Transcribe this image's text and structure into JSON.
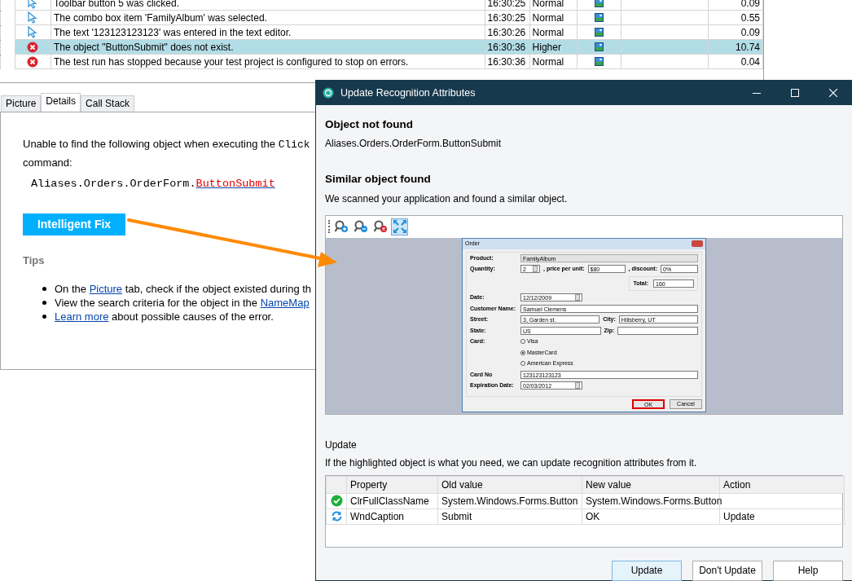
{
  "log": {
    "rows": [
      {
        "kind": "click",
        "message": "Toolbar button 5 was clicked.",
        "time": "16:30:25",
        "priority": "Normal",
        "value": "0.09",
        "selected": false
      },
      {
        "kind": "click",
        "message": "The combo box item 'FamilyAlbum' was selected.",
        "time": "16:30:25",
        "priority": "Normal",
        "value": "0.55",
        "selected": false
      },
      {
        "kind": "click",
        "message": "The text '123123123123' was entered in the text editor.",
        "time": "16:30:26",
        "priority": "Normal",
        "value": "0.09",
        "selected": false
      },
      {
        "kind": "error",
        "message": "The object \"ButtonSubmit\" does not exist.",
        "time": "16:30:36",
        "priority": "Higher",
        "value": "10.74",
        "selected": true
      },
      {
        "kind": "error",
        "message": "The test run has stopped because your test project is configured to stop on errors.",
        "time": "16:30:36",
        "priority": "Normal",
        "value": "0.04",
        "selected": false
      }
    ]
  },
  "details_tabs": [
    {
      "label": "Picture",
      "selected": false
    },
    {
      "label": "Details",
      "selected": true
    },
    {
      "label": "Call Stack",
      "selected": false
    }
  ],
  "details": {
    "message": {
      "text": "Unable to find the following object when executing the ",
      "code": "Click",
      "after": "command:"
    },
    "object_path": {
      "prefix": "Aliases.Orders.OrderForm.",
      "link": "ButtonSubmit"
    },
    "fix_button": "Intelligent Fix",
    "tips_heading": "Tips",
    "tips": [
      [
        {
          "text": "On the "
        },
        {
          "link": "Picture"
        },
        {
          "text": " tab, check if the object existed during th"
        }
      ],
      [
        {
          "text": "View the search criteria for the object in the "
        },
        {
          "link": "NameMap"
        }
      ],
      [
        {
          "link": "Learn more"
        },
        {
          "text": " about possible causes of the error."
        }
      ]
    ]
  },
  "dialog": {
    "title": "Update Recognition Attributes",
    "not_found_heading": "Object not found",
    "not_found_path": "Aliases.Orders.OrderForm.ButtonSubmit",
    "similar_heading": "Similar object found",
    "similar_text": "We scanned your application and found a similar object.",
    "viewer_tools": [
      {
        "kind": "zoom-in",
        "selected": false
      },
      {
        "kind": "zoom-out",
        "selected": false
      },
      {
        "kind": "zoom-reset",
        "selected": false
      },
      {
        "kind": "fit",
        "selected": true
      }
    ],
    "order_form": {
      "title": "Order",
      "rows": [
        {
          "items": [
            {
              "kind": "label",
              "text": "Product:"
            },
            {
              "kind": "combo",
              "value": "FamilyAlbum"
            }
          ]
        },
        {
          "items": [
            {
              "kind": "label",
              "text": "Quantity:"
            },
            {
              "kind": "spin",
              "value": "2"
            },
            {
              "kind": "label",
              "text": ", price per unit:"
            },
            {
              "kind": "input",
              "value": "$80"
            },
            {
              "kind": "label",
              "text": ", discount:"
            },
            {
              "kind": "input",
              "value": "0%"
            }
          ]
        },
        {
          "kind": "total",
          "items": [
            {
              "kind": "label",
              "text": "Total:"
            },
            {
              "kind": "input",
              "value": "160"
            }
          ]
        },
        {
          "items": [
            {
              "kind": "label",
              "text": "Date:"
            },
            {
              "kind": "spin",
              "value": "12/12/2009"
            }
          ]
        },
        {
          "items": [
            {
              "kind": "label",
              "text": "Customer Name:"
            },
            {
              "kind": "input",
              "value": "Samuel Clemens"
            }
          ]
        },
        {
          "items": [
            {
              "kind": "label",
              "text": "Street:"
            },
            {
              "kind": "input",
              "value": "3, Garden st."
            },
            {
              "kind": "label",
              "text": "City:"
            },
            {
              "kind": "input",
              "value": "Hillsberry, UT"
            }
          ]
        },
        {
          "items": [
            {
              "kind": "label",
              "text": "State:"
            },
            {
              "kind": "input",
              "value": "US"
            },
            {
              "kind": "label",
              "text": "Zip:"
            },
            {
              "kind": "input"
            }
          ]
        },
        {
          "items": [
            {
              "kind": "label",
              "text": "Card:"
            },
            {
              "kind": "radio",
              "text": "Visa",
              "selected": false
            }
          ]
        },
        {
          "items": [
            {
              "kind": "radio",
              "text": "MasterCard",
              "selected": true
            }
          ]
        },
        {
          "items": [
            {
              "kind": "radio",
              "text": "American Express",
              "selected": false
            }
          ]
        },
        {
          "items": [
            {
              "kind": "label",
              "text": "Card No"
            },
            {
              "kind": "input",
              "value": "123123123123"
            }
          ]
        },
        {
          "items": [
            {
              "kind": "label",
              "text": "Expiration Date:"
            },
            {
              "kind": "spin",
              "value": "02/03/2012"
            }
          ]
        }
      ],
      "buttons": [
        {
          "label": "OK",
          "highlighted": true
        },
        {
          "label": "Cancel",
          "highlighted": false
        }
      ]
    },
    "update_heading": "Update",
    "update_text": "If the highlighted object is what you need, we can update recognition attributes from it.",
    "attributes": {
      "columns": [
        "Property",
        "Old value",
        "New value",
        "Action"
      ],
      "rows": [
        {
          "kind": "ok",
          "property": "ClrFullClassName",
          "old": "System.Windows.Forms.Button",
          "new": "System.Windows.Forms.Button"
        },
        {
          "kind": "update",
          "property": "WndCaption",
          "old": "Submit",
          "new": "OK",
          "action": "Update"
        }
      ]
    },
    "buttons": [
      {
        "label": "Update",
        "default": true
      },
      {
        "label": "Don't Update",
        "default": false
      },
      {
        "label": "Help",
        "default": false
      }
    ]
  }
}
